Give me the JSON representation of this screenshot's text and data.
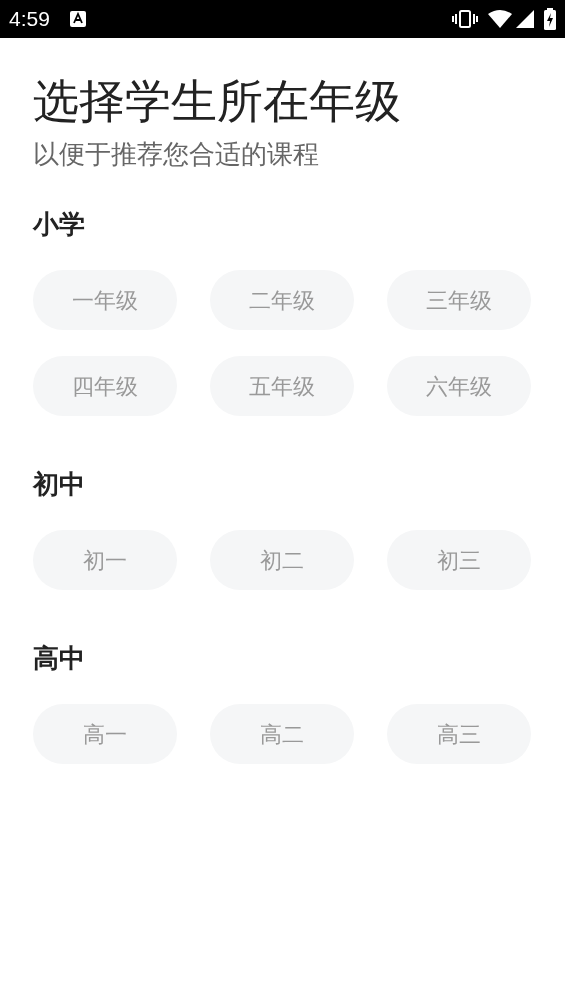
{
  "status_bar": {
    "time": "4:59"
  },
  "title": "选择学生所在年级",
  "subtitle": "以便于推荐您合适的课程",
  "sections": [
    {
      "heading": "小学",
      "grades": [
        {
          "label": "一年级",
          "selected": false
        },
        {
          "label": "二年级",
          "selected": false
        },
        {
          "label": "三年级",
          "selected": false
        },
        {
          "label": "四年级",
          "selected": false
        },
        {
          "label": "五年级",
          "selected": false
        },
        {
          "label": "六年级",
          "selected": false
        }
      ]
    },
    {
      "heading": "初中",
      "grades": [
        {
          "label": "初一",
          "selected": false
        },
        {
          "label": "初二",
          "selected": false
        },
        {
          "label": "初三",
          "selected": false
        }
      ]
    },
    {
      "heading": "高中",
      "grades": [
        {
          "label": "高一",
          "selected": false
        },
        {
          "label": "高二",
          "selected": false
        },
        {
          "label": "高三",
          "selected": false
        }
      ]
    }
  ]
}
